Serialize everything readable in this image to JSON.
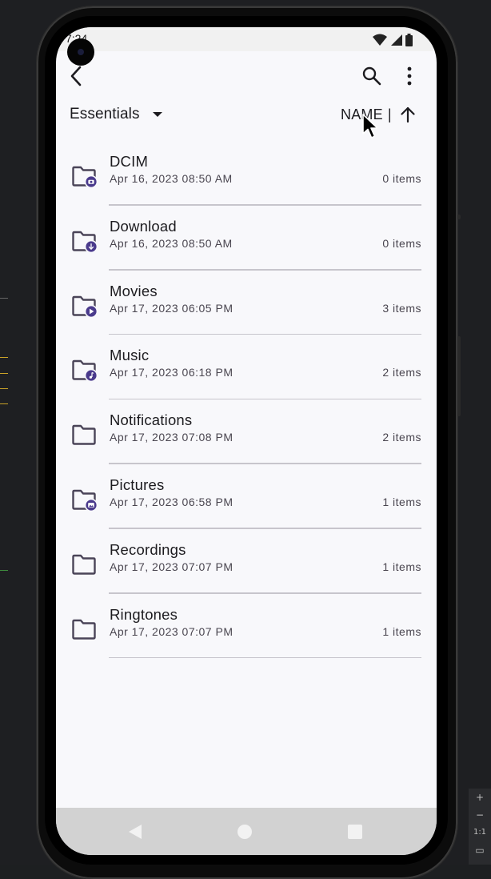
{
  "status_bar": {
    "time": "7:24"
  },
  "app_bar": {
    "back_icon": "arrow-back-icon",
    "search_icon": "search-icon",
    "more_icon": "more-vert-icon"
  },
  "filter_bar": {
    "storage_label": "Essentials",
    "sort_label": "NAME",
    "sort_separator": "|",
    "sort_direction": "ascending"
  },
  "folders": [
    {
      "name": "DCIM",
      "date": "Apr 16, 2023 08:50 AM",
      "count": "0 items",
      "badge": "camera"
    },
    {
      "name": "Download",
      "date": "Apr 16, 2023 08:50 AM",
      "count": "0 items",
      "badge": "download"
    },
    {
      "name": "Movies",
      "date": "Apr 17, 2023 06:05 PM",
      "count": "3 items",
      "badge": "play"
    },
    {
      "name": "Music",
      "date": "Apr 17, 2023 06:18 PM",
      "count": "2 items",
      "badge": "music"
    },
    {
      "name": "Notifications",
      "date": "Apr 17, 2023 07:08 PM",
      "count": "2 items",
      "badge": ""
    },
    {
      "name": "Pictures",
      "date": "Apr 17, 2023 06:58 PM",
      "count": "1 items",
      "badge": "image"
    },
    {
      "name": "Recordings",
      "date": "Apr 17, 2023 07:07 PM",
      "count": "1 items",
      "badge": ""
    },
    {
      "name": "Ringtones",
      "date": "Apr 17, 2023 07:07 PM",
      "count": "1 items",
      "badge": ""
    }
  ],
  "emulator_toolbar": {
    "zoom_in": "+",
    "zoom_out": "−",
    "actual_size": "1:1"
  },
  "colors": {
    "accent": "#4a3a8c",
    "folder_outline": "#4a4458",
    "background": "#f8f8fb",
    "divider": "#c7c5cc"
  }
}
